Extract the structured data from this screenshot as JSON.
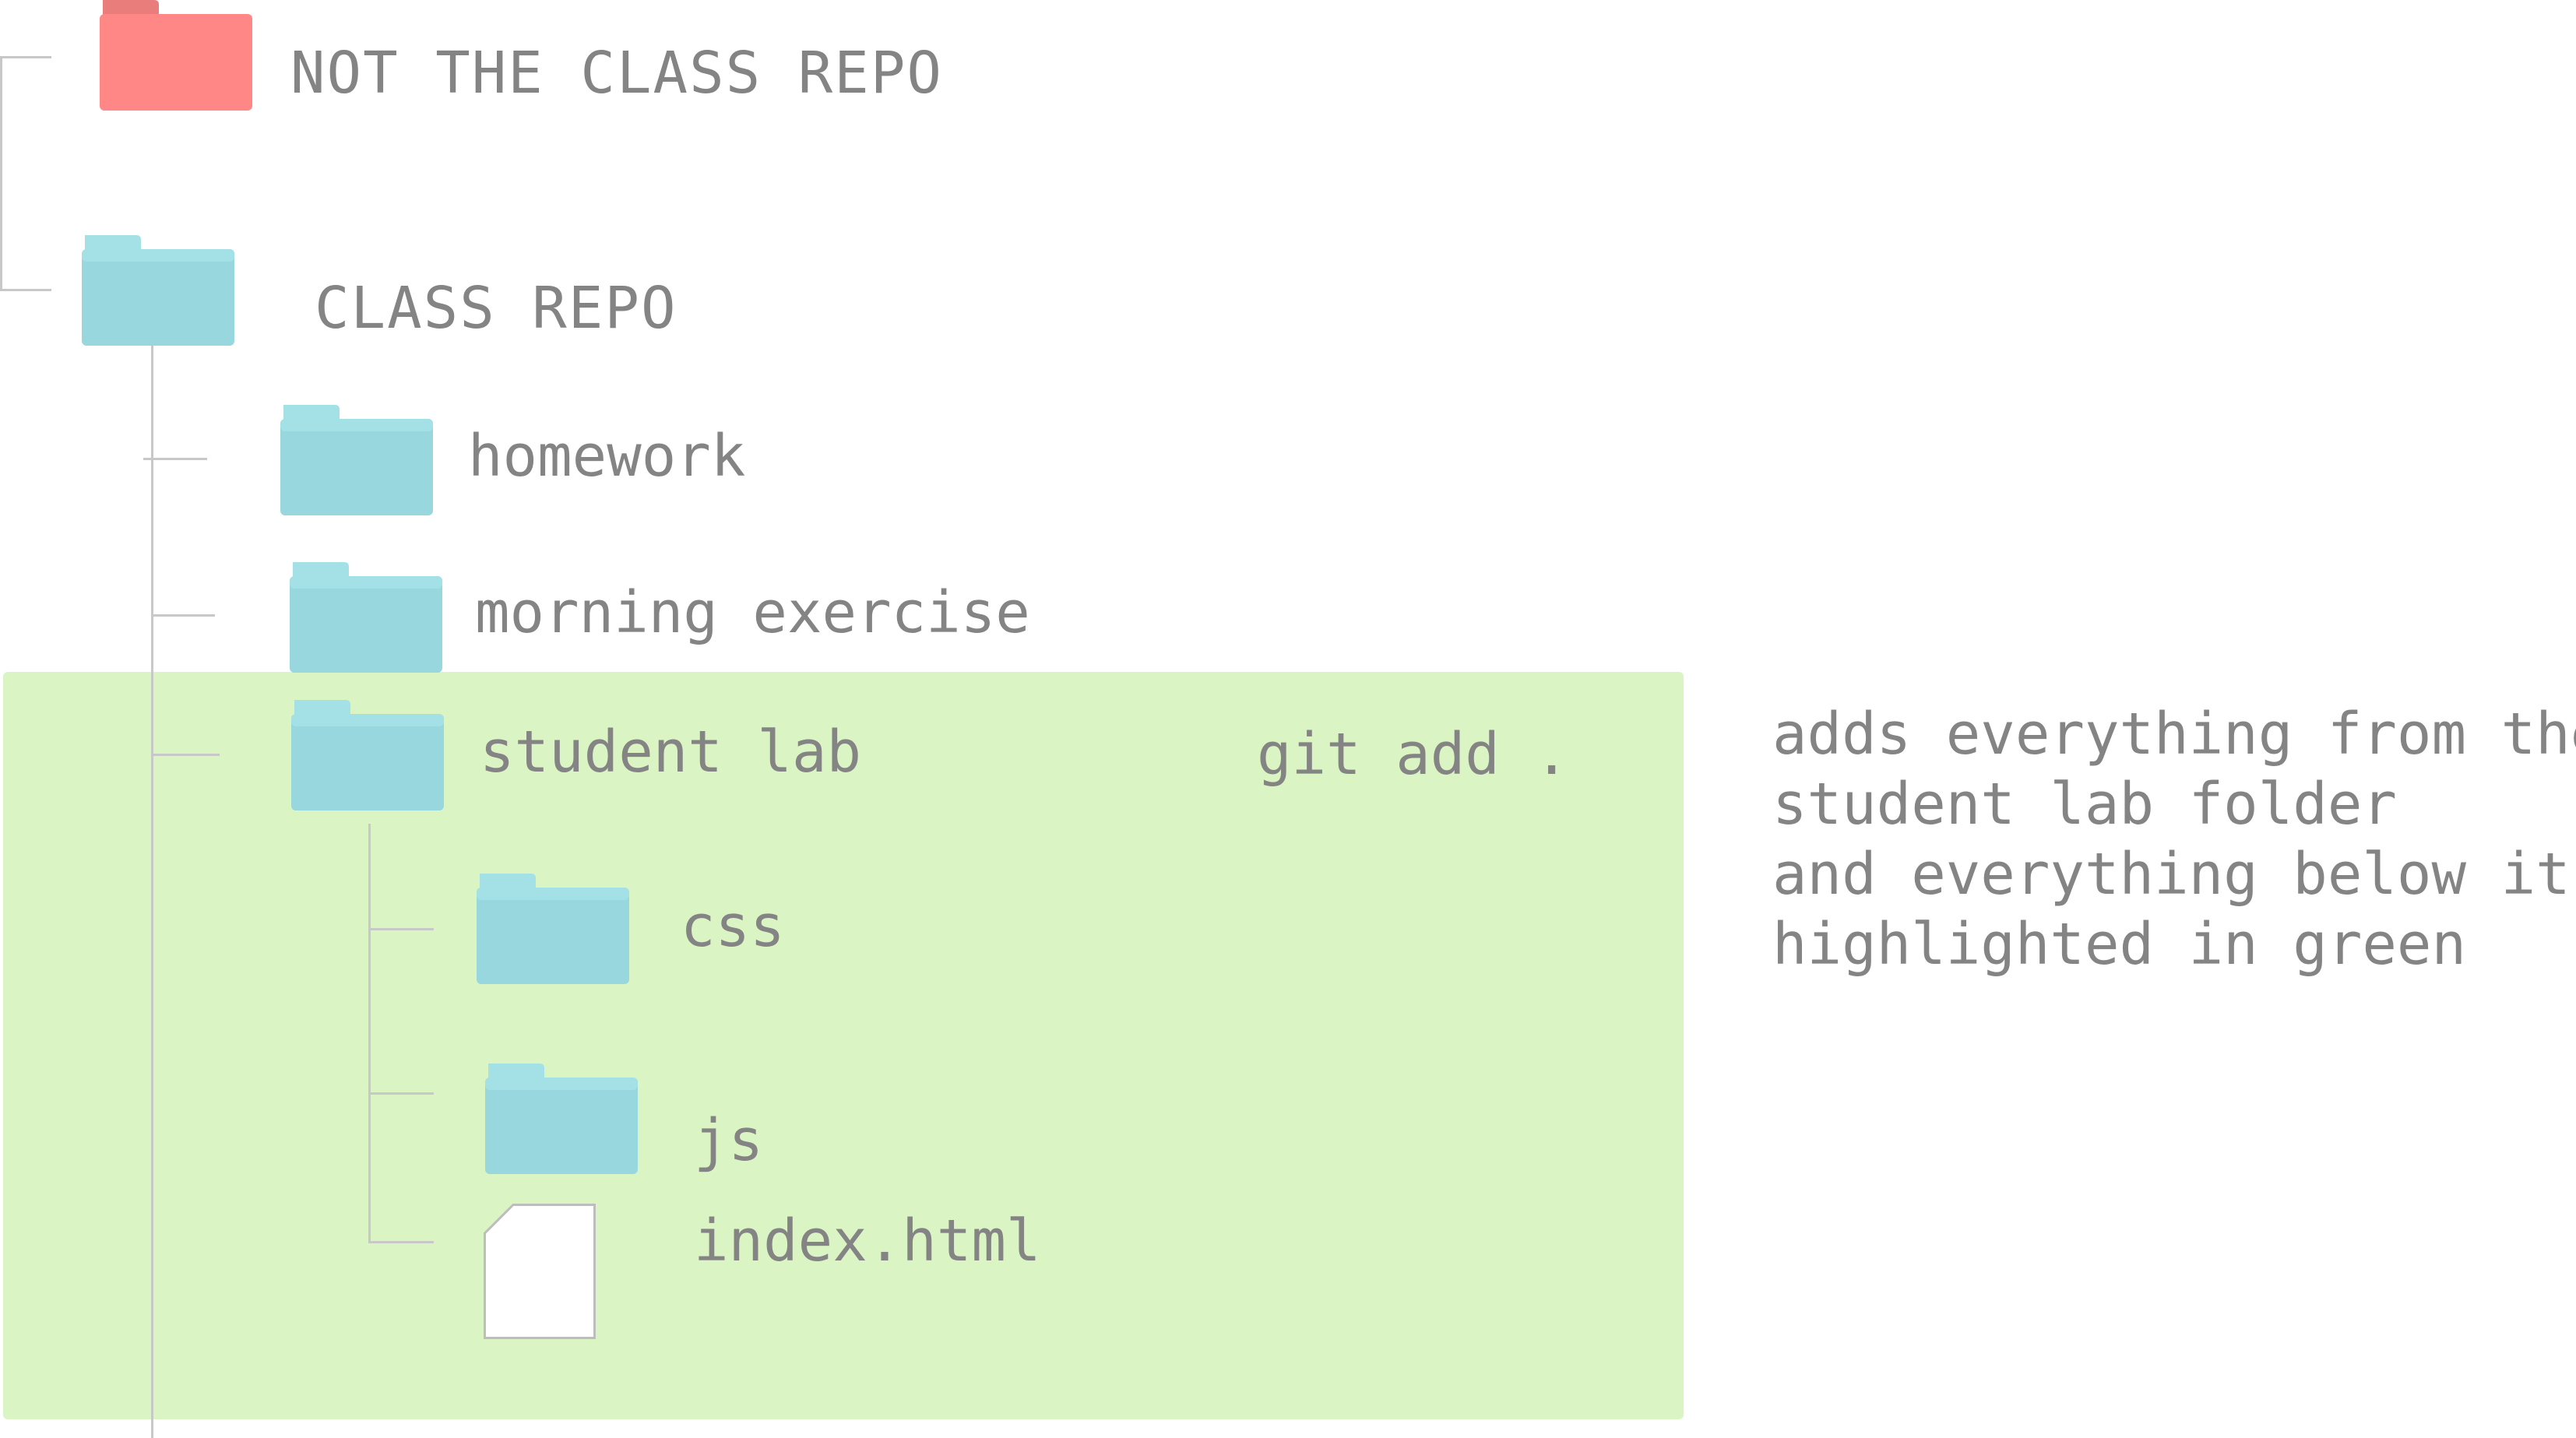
{
  "colors": {
    "highlight": "#daf4c3",
    "folder_teal": "#97d7dd",
    "folder_teal_tab": "#a3e1e6",
    "folder_red": "#ff8785",
    "folder_red_tab": "#e97d7c",
    "text": "#848484",
    "connector": "#c8c8c8"
  },
  "icons": {
    "folder": "folder-icon",
    "file": "file-icon"
  },
  "tree": {
    "not_class_repo": "NOT THE CLASS REPO",
    "class_repo": "CLASS REPO",
    "homework": "homework",
    "morning_exercise": "morning exercise",
    "student_lab": "student lab",
    "css": "css",
    "js": "js",
    "index_html": "index.html"
  },
  "command": "git add .",
  "annotation": [
    "adds everything from the",
    "student lab folder",
    "and everything below it",
    "highlighted in green"
  ]
}
